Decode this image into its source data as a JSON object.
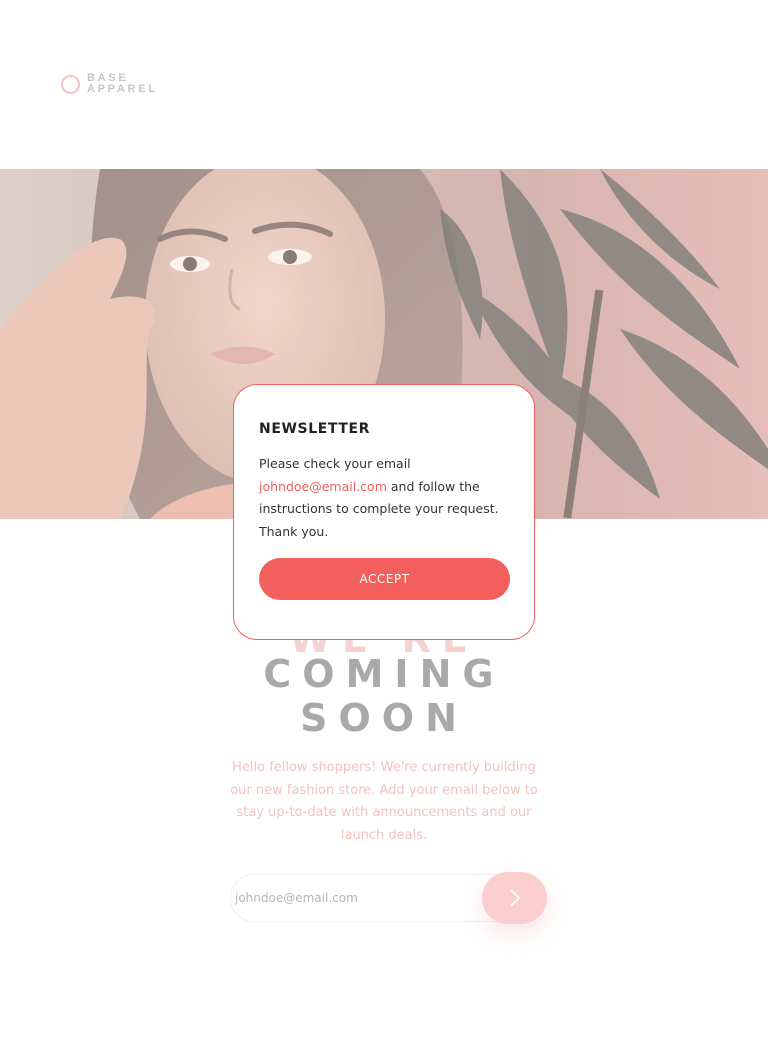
{
  "logo": {
    "line1": "BASE",
    "line2": "APPAREL"
  },
  "hero": {
    "image": "woman-portrait-with-plant"
  },
  "heading": {
    "line1": "WE'RE",
    "line2": "COMING",
    "line3": "SOON"
  },
  "intro": {
    "text": "Hello fellow shoppers! We're currently building our new fashion store. Add your email below to stay up-to-date with announcements and our launch deals."
  },
  "form": {
    "email_value": "johndoe@email.com",
    "submit_icon": "chevron-right-icon"
  },
  "modal": {
    "title": "NEWSLETTER",
    "body_before": "Please check your email",
    "email": "johndoe@email.com",
    "body_after": "and follow the instructions to complete your request. Thank you.",
    "accept_label": "ACCEPT"
  },
  "colors": {
    "accent": "#f25f5c",
    "soft_accent": "#f9c4c3",
    "heading": "#969696"
  }
}
